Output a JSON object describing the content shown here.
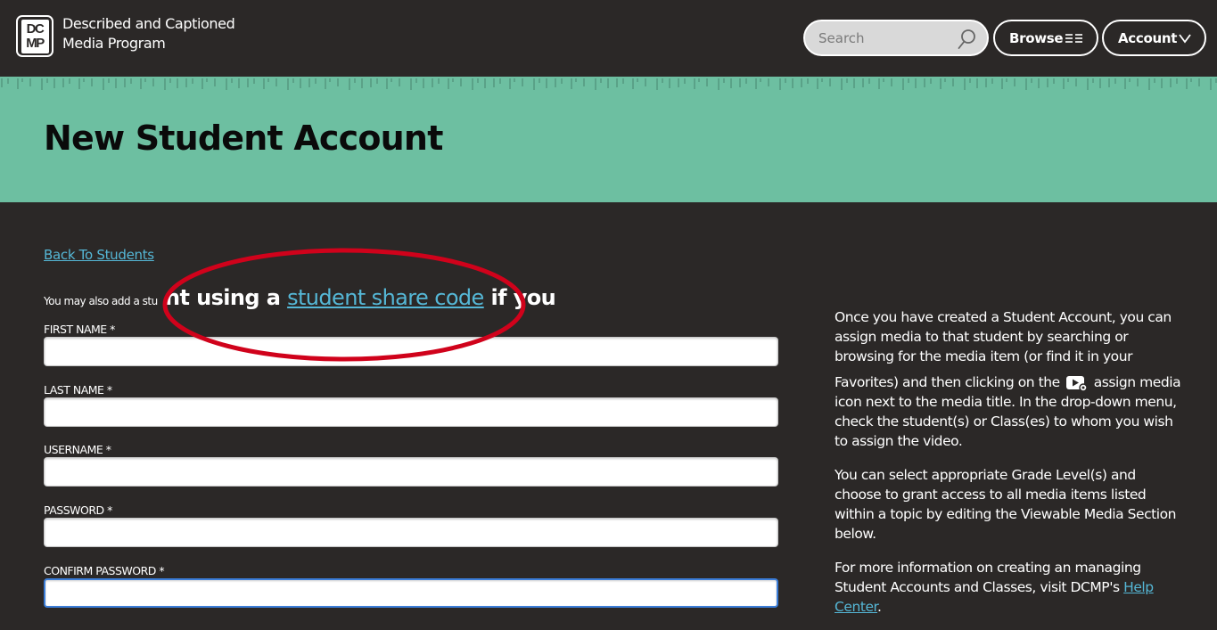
{
  "header": {
    "logo_lines": [
      "DC",
      "MP"
    ],
    "brand_line1": "Described and Captioned",
    "brand_line2": "Media Program",
    "search": {
      "placeholder": "Search",
      "value": ""
    },
    "browse_label": "Browse",
    "account_label": "Account"
  },
  "page": {
    "title": "New Student Account",
    "back_link": "Back To Students",
    "intro_small": "You may also add a stu",
    "magnified": {
      "prefix": "nt using a ",
      "link": "student share code",
      "suffix": " if you"
    }
  },
  "form": {
    "fields": [
      {
        "label": "FIRST NAME *",
        "value": ""
      },
      {
        "label": "LAST NAME *",
        "value": ""
      },
      {
        "label": "USERNAME *",
        "value": ""
      },
      {
        "label": "PASSWORD *",
        "value": ""
      },
      {
        "label": "CONFIRM PASSWORD *",
        "value": ""
      }
    ]
  },
  "sidebar": {
    "p1_a": "Once you have created a Student Account, you can assign media to that student by searching or browsing for the media item (or find it in your",
    "p1_b": "Favorites) and then clicking on the",
    "p1_c": "assign media icon next to the media title. In the drop-down menu, check the student(s) or Class(es) to whom you wish to assign the video.",
    "p2": "You can select appropriate Grade Level(s) and choose to grant access to all media items listed within a topic by editing the Viewable Media Section below.",
    "p3_text": "For more information on creating an managing Student Accounts and Classes, visit DCMP's",
    "p3_link": "Help Center",
    "p3_end": "."
  },
  "colors": {
    "background": "#2b2827",
    "band": "#6dbfa1",
    "link": "#55b7d6",
    "annotation": "#d0021b",
    "focus": "#3b7dd8"
  }
}
